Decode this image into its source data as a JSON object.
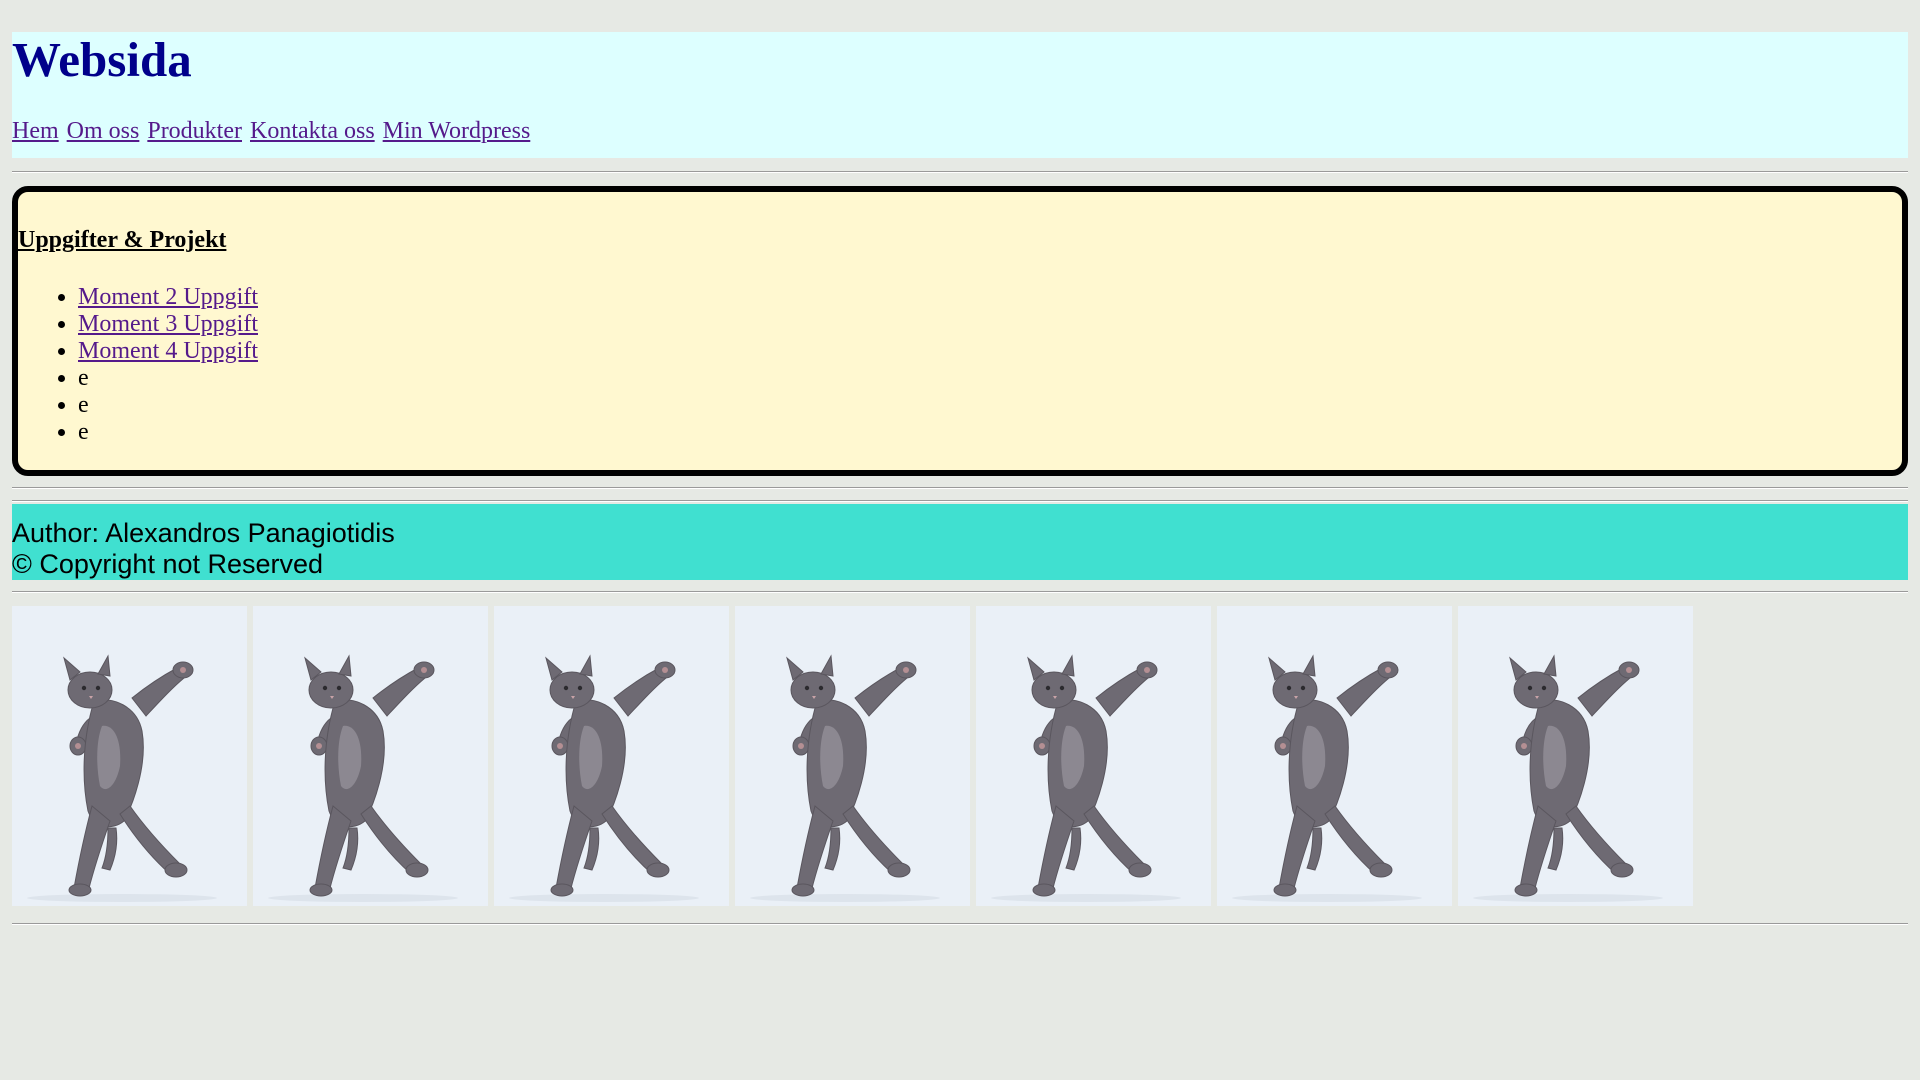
{
  "header": {
    "title": "Websida",
    "nav": [
      "Hem",
      "Om oss",
      "Produkter",
      "Kontakta oss",
      "Min Wordpress"
    ]
  },
  "tasks": {
    "title": "Uppgifter & Projekt",
    "links": [
      "Moment 2 Uppgift",
      "Moment 3 Uppgift",
      "Moment 4 Uppgift"
    ],
    "items": [
      "e",
      "e",
      "e"
    ]
  },
  "footer": {
    "author": "Author: Alexandros Panagiotidis",
    "copyright": "© Copyright not Reserved"
  },
  "gallery": {
    "image_count": 7,
    "image_subject": "dancing-cat"
  },
  "colors": {
    "page_bg": "#e6e9e4",
    "header_bg": "#ddffff",
    "title": "#00008b",
    "link": "#551a8b",
    "tasks_bg": "#fff8d0",
    "footer_bg": "#40e0d0"
  }
}
